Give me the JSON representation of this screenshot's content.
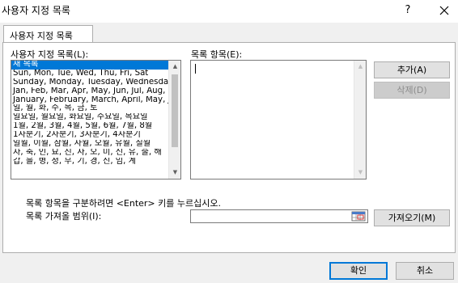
{
  "window": {
    "title": "사용자 지정 목록",
    "help_label": "?"
  },
  "tab": {
    "label": "사용자 지정 목록"
  },
  "custom_lists": {
    "label": "사용자 지정 목록(L):",
    "items": [
      "새 목록",
      "Sun, Mon, Tue, Wed, Thu, Fri, Sat",
      "Sunday, Monday, Tuesday, Wednesday, Thursday, Friday, Saturday",
      "Jan, Feb, Mar, Apr, May, Jun, Jul, Aug, Sep, Oct, Nov, Dec",
      "January, February, March, April, May, June, July",
      "일, 월, 화, 수, 목, 금, 토",
      "일요일, 월요일, 화요일, 수요일, 목요일",
      "1월, 2월, 3월, 4월, 5월, 6월, 7월, 8월",
      "1사분기, 2사분기, 3사분기, 4사분기",
      "일월, 이월, 삼월, 사월, 오월, 유월, 칠월",
      "자, 축, 인, 묘, 진, 사, 오, 미, 신, 유, 술, 해",
      "갑, 을, 병, 정, 무, 기, 경, 신, 임, 계"
    ],
    "selected_index": 0
  },
  "list_entries": {
    "label": "목록 항목(E):",
    "value": ""
  },
  "buttons": {
    "add": "추가(A)",
    "delete": "삭제(D)",
    "import": "가져오기(M)",
    "ok": "확인",
    "cancel": "취소"
  },
  "hint": "목록 항목을 구분하려면 <Enter> 키를 누르십시오.",
  "import_range": {
    "label": "목록 가져올 범위(I):",
    "value": ""
  },
  "icons": {
    "close": "close-icon",
    "scroll_up": "scroll-up-arrow-icon",
    "scroll_down": "scroll-down-arrow-icon",
    "range_picker": "range-picker-icon"
  },
  "colors": {
    "selection": "#0078d7",
    "panel_bg": "#ffffff",
    "window_bg": "#f0f0f0"
  }
}
